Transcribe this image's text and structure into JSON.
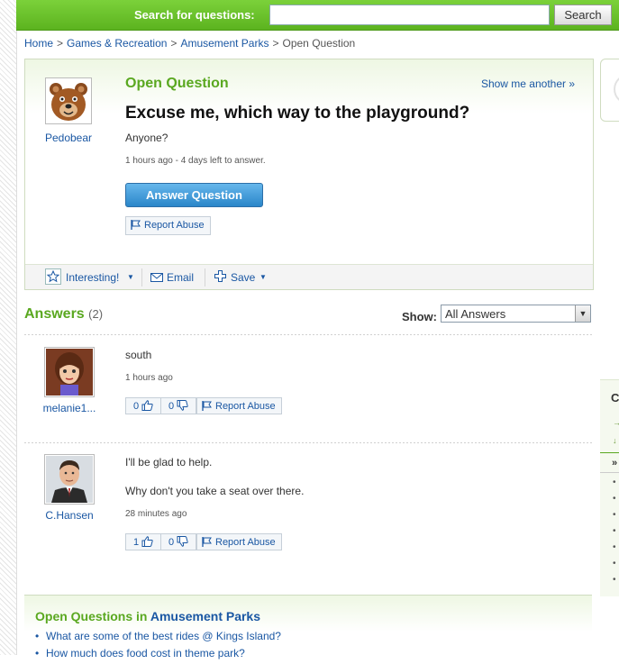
{
  "header": {
    "search_label": "Search for questions:",
    "search_value": "",
    "search_button": "Search"
  },
  "breadcrumb": [
    "Home",
    "Games & Recreation",
    "Amusement Parks",
    "Open Question"
  ],
  "question": {
    "status": "Open Question",
    "show_another": "Show me another »",
    "title": "Excuse me, which way to the playground?",
    "body": "Anyone?",
    "meta": "1 hours ago - 4 days left to answer.",
    "author": "Pedobear",
    "answer_button": "Answer Question",
    "report_abuse": "Report Abuse",
    "actions": {
      "interesting": "Interesting!",
      "email": "Email",
      "save": "Save"
    }
  },
  "answers": {
    "heading": "Answers",
    "count": "(2)",
    "show_label": "Show:",
    "show_selected": "All Answers",
    "items": [
      {
        "author": "melanie1...",
        "lines": [
          "south"
        ],
        "time": "1 hours ago",
        "thumbs_up": "0",
        "thumbs_down": "0",
        "report": "Report Abuse"
      },
      {
        "author": "C.Hansen",
        "lines": [
          "I'll be glad to help.",
          "Why don't you take a seat over there."
        ],
        "time": "28 minutes ago",
        "thumbs_up": "1",
        "thumbs_down": "0",
        "report": "Report Abuse"
      }
    ]
  },
  "open_questions": {
    "title_prefix": "Open Questions in",
    "category": "Amusement Parks",
    "items": [
      "What are some of the best rides @ Kings Island?",
      "How much does food cost in theme park?"
    ]
  },
  "side": {
    "panel_letter": "C",
    "panel_marker": "»"
  },
  "colors": {
    "brand_green": "#5aa820",
    "link_blue": "#1a57a3",
    "button_blue": "#2a86c9"
  }
}
